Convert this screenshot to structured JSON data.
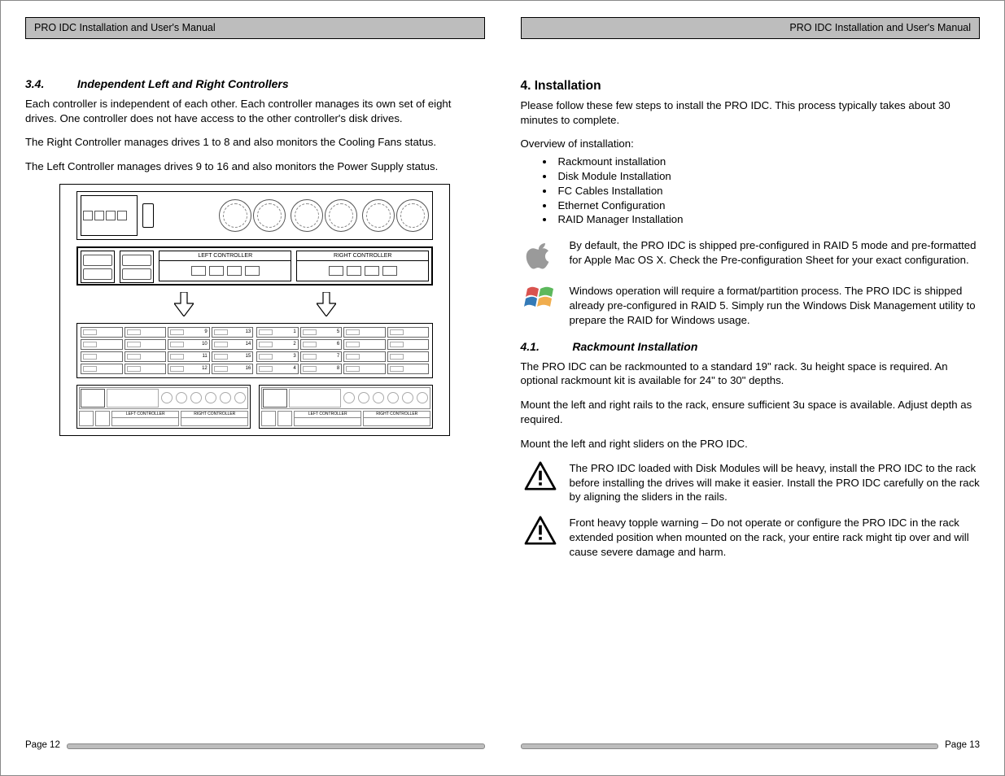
{
  "header": {
    "title": "PRO IDC Installation and User's Manual"
  },
  "left": {
    "section": {
      "num": "3.4.",
      "title": "Independent Left and Right Controllers"
    },
    "p1": "Each controller is independent of each other.  Each controller manages its own set of eight drives.  One controller does not have access to the other controller's disk drives.",
    "p2": "The Right Controller manages drives 1 to 8 and also monitors the Cooling Fans status.",
    "p3": "The Left Controller manages drives 9 to 16 and also monitors the Power Supply status.",
    "diagram": {
      "left_ctrl": "LEFT CONTROLLER",
      "right_ctrl": "RIGHT CONTROLLER",
      "bays_left": [
        "9",
        "13",
        "10",
        "14",
        "11",
        "15",
        "12",
        "16"
      ],
      "bays_right": [
        "1",
        "5",
        "2",
        "6",
        "3",
        "7",
        "4",
        "8"
      ],
      "mini_left_ctrl": "LEFT CONTROLLER",
      "mini_right_ctrl": "RIGHT CONTROLLER"
    },
    "page_label": "Page 12"
  },
  "right": {
    "h2": "4. Installation",
    "p1": "Please follow these few steps to install the PRO IDC.  This process typically takes about  30 minutes to complete.",
    "overview": "Overview of installation:",
    "bullets": [
      "Rackmount installation",
      "Disk Module Installation",
      "FC Cables Installation",
      "Ethernet Configuration",
      "RAID Manager Installation"
    ],
    "apple_note": "By default, the PRO IDC is shipped pre-configured in RAID 5 mode and pre-formatted for Apple Mac OS X.  Check the Pre-configuration Sheet for your exact configuration.",
    "windows_note": "Windows operation will require a format/partition process.  The PRO IDC is shipped already pre-configured in RAID 5.   Simply run the Windows Disk Management utility to prepare the RAID for Windows usage.",
    "section41": {
      "num": "4.1.",
      "title": "Rackmount Installation"
    },
    "p41a": "The PRO IDC can be rackmounted to a standard 19\" rack.  3u height space is required.  An optional rackmount kit is available for 24\" to 30\" depths.",
    "p41b": "Mount the left and right rails to the rack, ensure sufficient 3u space is available.  Adjust depth as required.",
    "p41c": "Mount the left and right sliders on the PRO IDC.",
    "warn1": "The PRO IDC loaded with Disk Modules will be heavy, install the PRO IDC to the rack before installing the drives will make it easier.  Install the PRO IDC carefully on the rack by aligning the sliders in the rails.",
    "warn2": "Front heavy topple warning – Do not operate or configure the PRO IDC in the rack extended position when mounted on the rack, your entire rack might tip over and will cause severe damage and harm.",
    "page_label": "Page 13"
  }
}
